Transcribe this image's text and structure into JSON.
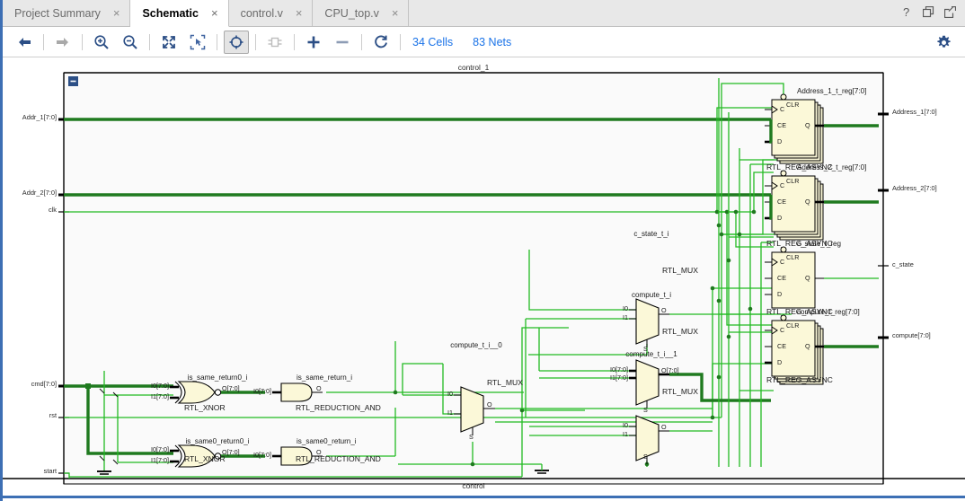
{
  "window": {
    "header_icons": [
      {
        "name": "help-icon",
        "glyph": "?"
      },
      {
        "name": "float-icon",
        "glyph": "⧉"
      },
      {
        "name": "maximize-icon",
        "glyph": "↗"
      }
    ]
  },
  "tabs": [
    {
      "label": "Project Summary",
      "active": false,
      "close": "×"
    },
    {
      "label": "Schematic",
      "active": true,
      "close": "×"
    },
    {
      "label": "control.v",
      "active": false,
      "close": "×"
    },
    {
      "label": "CPU_top.v",
      "active": false,
      "close": "×"
    }
  ],
  "toolbar": {
    "buttons": [
      {
        "name": "back-button",
        "icon": "arrow-left-icon",
        "enabled": true,
        "toggled": false
      },
      {
        "name": "forward-button",
        "icon": "arrow-right-icon",
        "enabled": false,
        "toggled": false
      },
      {
        "name": "zoom-in-button",
        "icon": "zoom-in-icon",
        "enabled": true,
        "toggled": false
      },
      {
        "name": "zoom-out-button",
        "icon": "zoom-out-icon",
        "enabled": true,
        "toggled": false
      },
      {
        "name": "zoom-fit-button",
        "icon": "zoom-fit-icon",
        "enabled": true,
        "toggled": false
      },
      {
        "name": "zoom-area-button",
        "icon": "zoom-area-icon",
        "enabled": true,
        "toggled": false
      },
      {
        "name": "highlight-button",
        "icon": "target-icon",
        "enabled": true,
        "toggled": true
      },
      {
        "name": "expand-cell-button",
        "icon": "cell-icon",
        "enabled": false,
        "toggled": false
      },
      {
        "name": "add-button",
        "icon": "plus-icon",
        "enabled": true,
        "toggled": false
      },
      {
        "name": "remove-button",
        "icon": "minus-icon",
        "enabled": true,
        "toggled": false
      },
      {
        "name": "reload-button",
        "icon": "refresh-icon",
        "enabled": true,
        "toggled": false
      }
    ],
    "cells_count": "34 Cells",
    "nets_count": "83 Nets",
    "settings_icon": "gear-icon"
  },
  "schematic": {
    "top_block_label": "control_1",
    "bottom_block_label": "control",
    "colors": {
      "bus": "#1f7a1f",
      "net": "#22bb22",
      "body": "#fbf8d8",
      "outline": "#000000",
      "accent": "#3d6fb4",
      "canvas_bg": "#fafafa"
    },
    "input_ports": [
      {
        "name": "Addr_1[7:0]",
        "bus": true
      },
      {
        "name": "Addr_2[7:0]",
        "bus": true
      },
      {
        "name": "clk",
        "bus": false
      },
      {
        "name": "cmd[7:0]",
        "bus": true
      },
      {
        "name": "rst",
        "bus": false
      },
      {
        "name": "start",
        "bus": false
      }
    ],
    "output_ports": [
      {
        "name": "Address_1[7:0]",
        "bus": true
      },
      {
        "name": "Address_2[7:0]",
        "bus": true
      },
      {
        "name": "c_state",
        "bus": false
      },
      {
        "name": "compute[7:0]",
        "bus": true
      }
    ],
    "cells": [
      {
        "instance": "Address_1_t_reg[7:0]",
        "type": "RTL_REG_ASYNC",
        "pins_in": [
          "CLR",
          "C",
          "CE",
          "D"
        ],
        "pins_out": [
          "Q"
        ],
        "stacked": true
      },
      {
        "instance": "Address_2_t_reg[7:0]",
        "type": "RTL_REG_ASYNC",
        "pins_in": [
          "CLR",
          "C",
          "CE",
          "D"
        ],
        "pins_out": [
          "Q"
        ],
        "stacked": true
      },
      {
        "instance": "c_state_t_reg",
        "type": "RTL_REG_ASYNC",
        "pins_in": [
          "CLR",
          "C",
          "CE",
          "D"
        ],
        "pins_out": [
          "Q"
        ],
        "stacked": false
      },
      {
        "instance": "compute_t_reg[7:0]",
        "type": "RTL_REG_ASYNC",
        "pins_in": [
          "CLR",
          "C",
          "CE",
          "D"
        ],
        "pins_out": [
          "Q"
        ],
        "stacked": true
      },
      {
        "instance": "c_state_t_i",
        "type": "RTL_MUX",
        "pins_in": [
          "I0",
          "I1",
          "S"
        ],
        "pins_out": [
          "O"
        ]
      },
      {
        "instance": "compute_t_i",
        "type": "RTL_MUX",
        "pins_in": [
          "I0[7:0]",
          "I1[7:0]",
          "S"
        ],
        "pins_out": [
          "O[7:0]"
        ]
      },
      {
        "instance": "compute_t_i__0",
        "type": "RTL_MUX",
        "pins_in": [
          "I0",
          "I1",
          "S"
        ],
        "pins_out": [
          "O"
        ]
      },
      {
        "instance": "compute_t_i__1",
        "type": "RTL_MUX",
        "pins_in": [
          "I0",
          "I1",
          "S"
        ],
        "pins_out": [
          "O"
        ]
      },
      {
        "instance": "is_same_return0_i",
        "type": "RTL_XNOR",
        "pins_in": [
          "I0[7:0]",
          "I1[7:0]"
        ],
        "pins_out": [
          "O[7:0]"
        ]
      },
      {
        "instance": "is_same0_return0_i",
        "type": "RTL_XNOR",
        "pins_in": [
          "I0[7:0]",
          "I1[7:0]"
        ],
        "pins_out": [
          "O[7:0]"
        ]
      },
      {
        "instance": "is_same_return_i",
        "type": "RTL_REDUCTION_AND",
        "pins_in": [
          "I0[7:0]"
        ],
        "pins_out": [
          "O"
        ]
      },
      {
        "instance": "is_same0_return_i",
        "type": "RTL_REDUCTION_AND",
        "pins_in": [
          "I0[7:0]"
        ],
        "pins_out": [
          "O"
        ]
      }
    ]
  }
}
